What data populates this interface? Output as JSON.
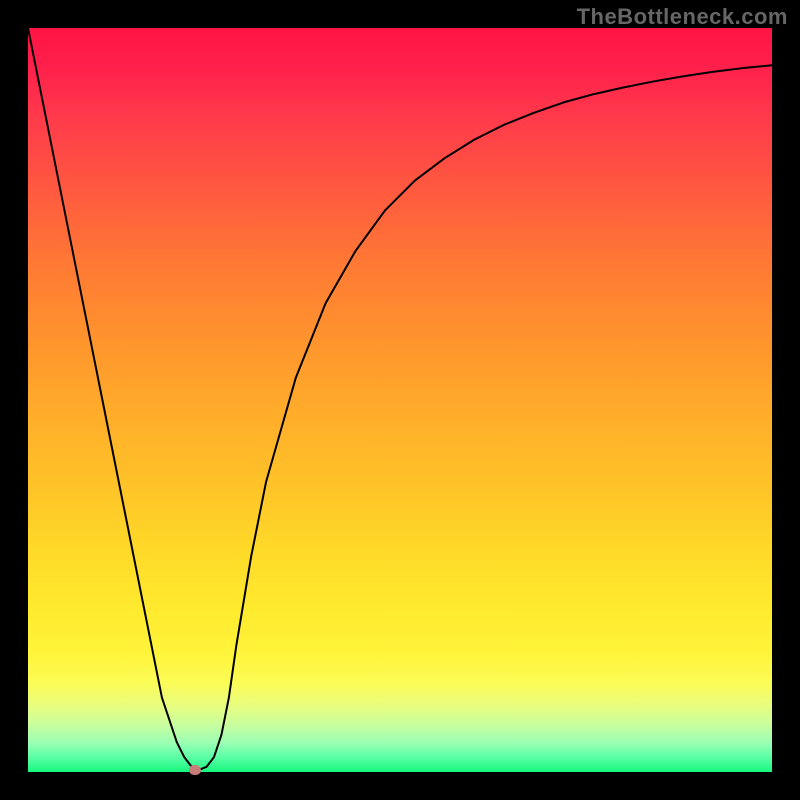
{
  "watermark": "TheBottleneck.com",
  "chart_data": {
    "type": "line",
    "title": "",
    "xlabel": "",
    "ylabel": "",
    "xlim": [
      0,
      100
    ],
    "ylim": [
      0,
      100
    ],
    "grid": false,
    "series": [
      {
        "name": "curve",
        "x": [
          0,
          2,
          4,
          6,
          8,
          10,
          12,
          14,
          16,
          18,
          20,
          21,
          22,
          23,
          24,
          25,
          26,
          27,
          28,
          30,
          32,
          34,
          36,
          38,
          40,
          44,
          48,
          52,
          56,
          60,
          64,
          68,
          72,
          76,
          80,
          84,
          88,
          92,
          96,
          100
        ],
        "y": [
          100,
          90,
          80,
          70,
          60,
          50,
          40,
          30,
          20,
          10,
          4,
          2,
          0.7,
          0.3,
          0.7,
          2,
          5,
          10,
          17,
          29,
          39,
          46,
          53,
          58,
          63,
          70,
          75.5,
          79.5,
          82.5,
          85,
          87,
          88.6,
          90,
          91.1,
          92,
          92.8,
          93.5,
          94.1,
          94.6,
          95
        ]
      }
    ],
    "marker": {
      "x": 22.5,
      "y": 0.3
    }
  },
  "colors": {
    "curve": "#000000",
    "marker": "#c77b7b",
    "frame": "#000000"
  }
}
